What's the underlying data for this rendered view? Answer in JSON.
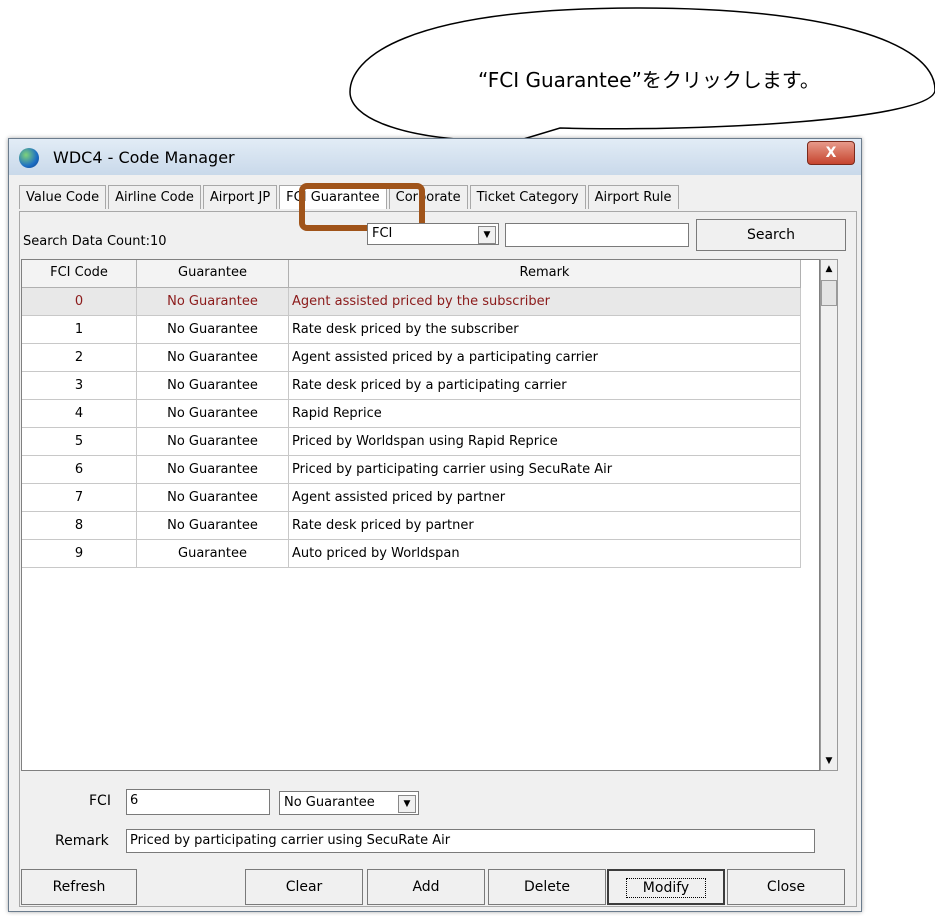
{
  "callout": {
    "text": "“FCI Guarantee”をクリックします。"
  },
  "window": {
    "title": "WDC4 - Code Manager",
    "close_label": "X"
  },
  "tabs": [
    {
      "label": "Value Code"
    },
    {
      "label": "Airline Code"
    },
    {
      "label": "Airport JP"
    },
    {
      "label": "FCI Guarantee",
      "active": true
    },
    {
      "label": "Corporate"
    },
    {
      "label": "Ticket Category"
    },
    {
      "label": "Airport Rule"
    }
  ],
  "search": {
    "count_label": "Search Data Count:10",
    "field_select": "FCI",
    "query": "",
    "button": "Search"
  },
  "grid": {
    "columns": [
      "FCI Code",
      "Guarantee",
      "Remark"
    ],
    "rows": [
      {
        "code": "0",
        "guarantee": "No Guarantee",
        "remark": "Agent assisted priced by the subscriber",
        "selected": true
      },
      {
        "code": "1",
        "guarantee": "No Guarantee",
        "remark": "Rate desk priced by the subscriber"
      },
      {
        "code": "2",
        "guarantee": "No Guarantee",
        "remark": "Agent assisted priced by a participating carrier"
      },
      {
        "code": "3",
        "guarantee": "No Guarantee",
        "remark": "Rate desk priced by a participating carrier"
      },
      {
        "code": "4",
        "guarantee": "No Guarantee",
        "remark": "Rapid Reprice"
      },
      {
        "code": "5",
        "guarantee": "No Guarantee",
        "remark": "Priced by Worldspan using Rapid Reprice"
      },
      {
        "code": "6",
        "guarantee": "No Guarantee",
        "remark": "Priced by participating carrier using SecuRate Air"
      },
      {
        "code": "7",
        "guarantee": "No Guarantee",
        "remark": "Agent assisted priced by partner"
      },
      {
        "code": "8",
        "guarantee": "No Guarantee",
        "remark": "Rate desk priced by partner"
      },
      {
        "code": "9",
        "guarantee": "Guarantee",
        "remark": "Auto priced by Worldspan"
      }
    ]
  },
  "form": {
    "fci_label": "FCI",
    "fci_value": "6",
    "guarantee_value": "No Guarantee",
    "remark_label": "Remark",
    "remark_value": "Priced by participating carrier using SecuRate Air"
  },
  "buttons": {
    "refresh": "Refresh",
    "clear": "Clear",
    "add": "Add",
    "delete": "Delete",
    "modify": "Modify",
    "close": "Close"
  },
  "colors": {
    "highlight": "#a0541a",
    "selected_text": "#8b1a1a"
  }
}
